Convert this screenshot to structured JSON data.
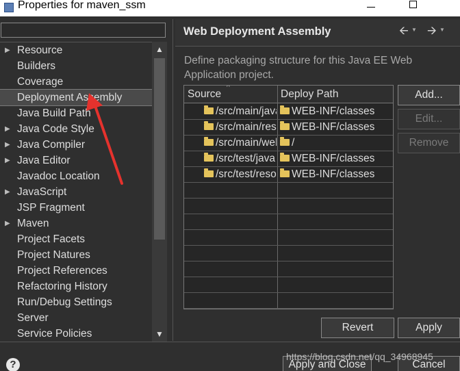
{
  "window": {
    "title": "Properties for maven_ssm"
  },
  "sidebar": {
    "filter_value": "",
    "items": [
      {
        "label": "Resource",
        "expandable": true
      },
      {
        "label": "Builders",
        "expandable": false
      },
      {
        "label": "Coverage",
        "expandable": false
      },
      {
        "label": "Deployment Assembly",
        "expandable": false,
        "selected": true
      },
      {
        "label": "Java Build Path",
        "expandable": false
      },
      {
        "label": "Java Code Style",
        "expandable": true
      },
      {
        "label": "Java Compiler",
        "expandable": true
      },
      {
        "label": "Java Editor",
        "expandable": true
      },
      {
        "label": "Javadoc Location",
        "expandable": false
      },
      {
        "label": "JavaScript",
        "expandable": true
      },
      {
        "label": "JSP Fragment",
        "expandable": false
      },
      {
        "label": "Maven",
        "expandable": true
      },
      {
        "label": "Project Facets",
        "expandable": false
      },
      {
        "label": "Project Natures",
        "expandable": false
      },
      {
        "label": "Project References",
        "expandable": false
      },
      {
        "label": "Refactoring History",
        "expandable": false
      },
      {
        "label": "Run/Debug Settings",
        "expandable": false
      },
      {
        "label": "Server",
        "expandable": false
      },
      {
        "label": "Service Policies",
        "expandable": false
      }
    ]
  },
  "page": {
    "title": "Web Deployment Assembly",
    "description": "Define packaging structure for this Java EE Web Application project.",
    "table": {
      "columns": [
        "Source",
        "Deploy Path"
      ],
      "rows": [
        {
          "source": "/src/main/java",
          "deploy": "WEB-INF/classes"
        },
        {
          "source": "/src/main/resources",
          "deploy": "WEB-INF/classes"
        },
        {
          "source": "/src/main/webapp",
          "deploy": "/"
        },
        {
          "source": "/src/test/java",
          "deploy": "WEB-INF/classes"
        },
        {
          "source": "/src/test/resources",
          "deploy": "WEB-INF/classes"
        }
      ]
    },
    "buttons": {
      "add": "Add...",
      "edit": "Edit...",
      "remove": "Remove",
      "revert": "Revert",
      "apply": "Apply"
    }
  },
  "footer": {
    "apply_close": "Apply and Close",
    "cancel": "Cancel",
    "watermark": "https://blog.csdn.net/qq_34968945"
  },
  "colors": {
    "annotation_arrow": "#e5322d",
    "folder": "#e4c35b"
  },
  "icons": {
    "back": "back-arrow-icon",
    "forward": "forward-arrow-icon",
    "help": "help-icon",
    "folder": "folder-icon"
  }
}
